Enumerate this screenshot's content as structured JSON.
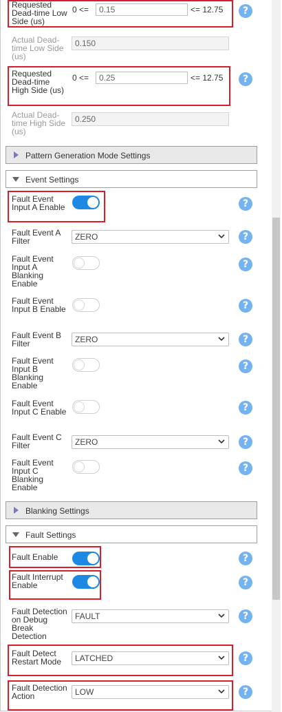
{
  "dead_time": {
    "low_side": {
      "label": "Requested Dead-time Low Side (us)",
      "min": "0 <=",
      "value": "0.15",
      "max": "<= 12.75"
    },
    "actual_low": {
      "label": "Actual Dead-time Low Side (us)",
      "value": "0.150"
    },
    "high_side": {
      "label": "Requested Dead-time High Side (us)",
      "min": "0 <=",
      "value": "0.25",
      "max": "<= 12.75"
    },
    "actual_high": {
      "label": "Actual Dead-time High Side (us)",
      "value": "0.250"
    }
  },
  "sections": {
    "pattern": "Pattern Generation Mode Settings",
    "event": "Event Settings",
    "blanking": "Blanking Settings",
    "fault": "Fault Settings"
  },
  "event_settings": [
    {
      "label": "Fault Event Input A Enable",
      "type": "toggle",
      "on": true
    },
    {
      "label": "Fault Event A Filter",
      "type": "select",
      "value": "ZERO"
    },
    {
      "label": "Fault Event Input A Blanking Enable",
      "type": "toggle",
      "on": false
    },
    {
      "label": "Fault Event Input B Enable",
      "type": "toggle",
      "on": false
    },
    {
      "label": "Fault Event B Filter",
      "type": "select",
      "value": "ZERO"
    },
    {
      "label": "Fault Event Input B Blanking Enable",
      "type": "toggle",
      "on": false
    },
    {
      "label": "Fault Event Input C Enable",
      "type": "toggle",
      "on": false
    },
    {
      "label": "Fault Event C Filter",
      "type": "select",
      "value": "ZERO"
    },
    {
      "label": "Fault Event Input C Blanking Enable",
      "type": "toggle",
      "on": false
    }
  ],
  "fault_settings": [
    {
      "label": "Fault Enable",
      "type": "toggle",
      "on": true
    },
    {
      "label": "Fault Interrupt Enable",
      "type": "toggle",
      "on": true
    },
    {
      "label": "Fault Detection on Debug Break Detection",
      "type": "select",
      "value": "FAULT"
    },
    {
      "label": "Fault Detect Restart Mode",
      "type": "select",
      "value": "LATCHED"
    },
    {
      "label": "Fault Detection Action",
      "type": "select",
      "value": "LOW"
    }
  ],
  "help_glyph": "?",
  "colors": {
    "highlight": "#d71e2b",
    "toggle_on": "#1e88e5",
    "help": "#74b3f0"
  }
}
